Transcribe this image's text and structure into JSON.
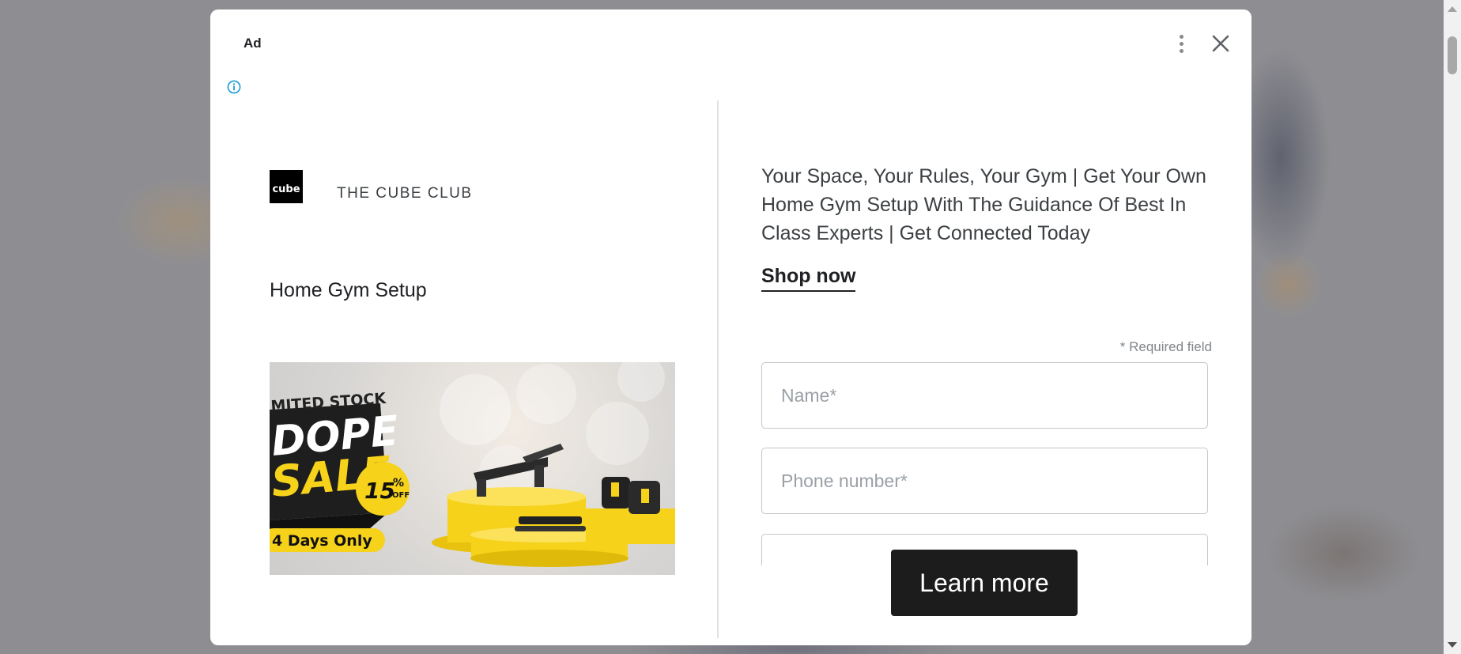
{
  "ad": {
    "label": "Ad",
    "advertiser_name": "THE CUBE CLUB",
    "logo_text": "cube",
    "headline": "Home Gym Setup",
    "description": "Your Space, Your Rules, Your Gym | Get Your Own Home Gym Setup With The Guidance Of Best In Class Experts | Get Connected Today",
    "shop_now_label": "Shop now",
    "required_note": "* Required field",
    "name_placeholder": "Name*",
    "phone_placeholder": "Phone number*",
    "cta_label": "Learn more"
  },
  "promo_image": {
    "limited_stock": "MITED STOCK",
    "dope": "DOPE",
    "sale": "SALE",
    "discount_pct": "15",
    "discount_pct_sign": "%",
    "discount_off": "OFF",
    "days_only": "4 Days Only"
  },
  "icons": {
    "kebab": "more-vert-icon",
    "close": "close-icon",
    "info": "info-icon"
  },
  "colors": {
    "cta_bg": "#1c1c1c",
    "promo_yellow": "#f6d21a",
    "info_icon": "#1a9bd7"
  }
}
